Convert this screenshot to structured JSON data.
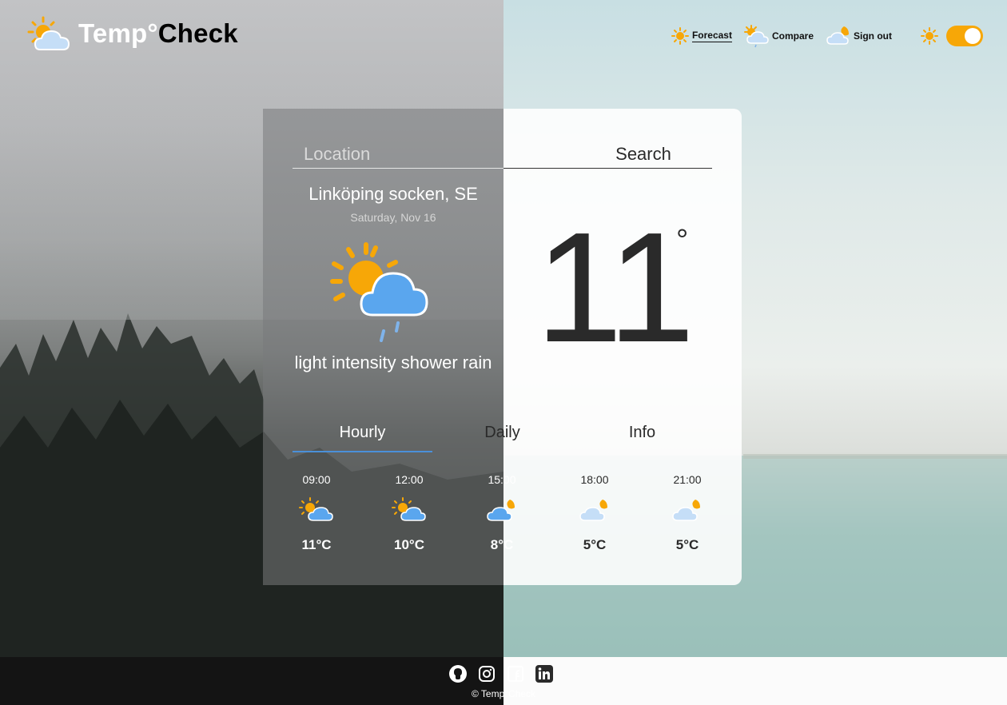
{
  "app": {
    "logo_temp": "Temp°",
    "logo_check": "Check"
  },
  "nav": {
    "forecast": "Forecast",
    "compare": "Compare",
    "signout": "Sign out",
    "theme_toggle": "on"
  },
  "search": {
    "placeholder": "Location",
    "button": "Search"
  },
  "current": {
    "city": "Linköping socken, SE",
    "date": "Saturday, Nov 16",
    "description": "light intensity shower rain",
    "temperature": "11",
    "degree": "°",
    "icon": "sun-cloud-rain-icon"
  },
  "tabs": {
    "hourly": "Hourly",
    "daily": "Daily",
    "info": "Info"
  },
  "hourly": [
    {
      "time": "09:00",
      "temp": "11°C",
      "icon": "sun-cloud-icon"
    },
    {
      "time": "12:00",
      "temp": "10°C",
      "icon": "sun-cloud-icon"
    },
    {
      "time": "15:00",
      "temp": "8°C",
      "icon": "moon-cloud-icon"
    },
    {
      "time": "18:00",
      "temp": "5°C",
      "icon": "moon-cloud-icon"
    },
    {
      "time": "21:00",
      "temp": "5°C",
      "icon": "moon-cloud-icon"
    }
  ],
  "footer": {
    "copyright": "© Temp°Check",
    "links": [
      "github-icon",
      "instagram-icon",
      "facebook-icon",
      "linkedin-icon"
    ]
  },
  "colors": {
    "accent_orange": "#f7a707",
    "tab_underline": "#4a90d9",
    "cloud_blue": "#5aa6ee"
  }
}
